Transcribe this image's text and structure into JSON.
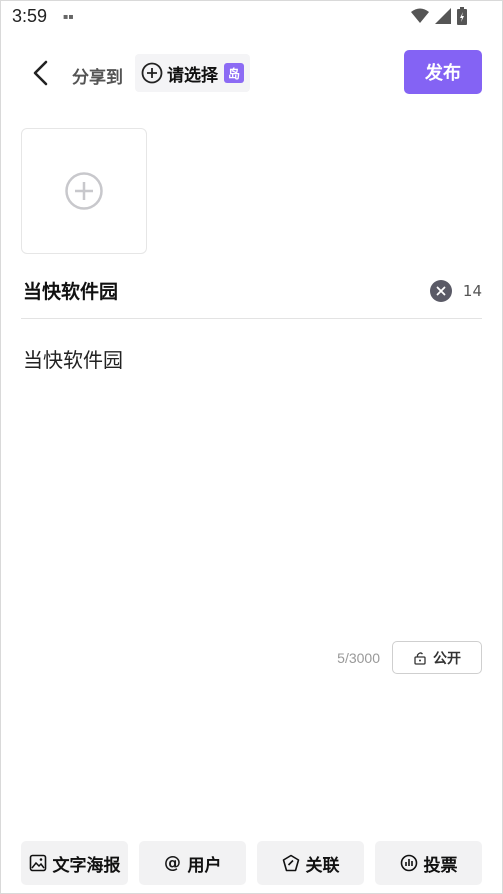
{
  "status_bar": {
    "time": "3:59"
  },
  "header": {
    "share_label": "分享到",
    "select_label": "请选择",
    "island_badge": "岛",
    "publish_label": "发布"
  },
  "title": {
    "value": "当快软件园",
    "count": "14"
  },
  "body": {
    "value": "当快软件园",
    "char_count": "5/3000",
    "privacy_label": "公开"
  },
  "toolbar": {
    "items": [
      {
        "label": "文字海报",
        "icon": "image-icon"
      },
      {
        "label": "用户",
        "icon": "at-icon"
      },
      {
        "label": "关联",
        "icon": "tag-icon"
      },
      {
        "label": "投票",
        "icon": "poll-icon"
      }
    ]
  },
  "colors": {
    "accent": "#8463f4",
    "badge": "#8c6bf4"
  }
}
